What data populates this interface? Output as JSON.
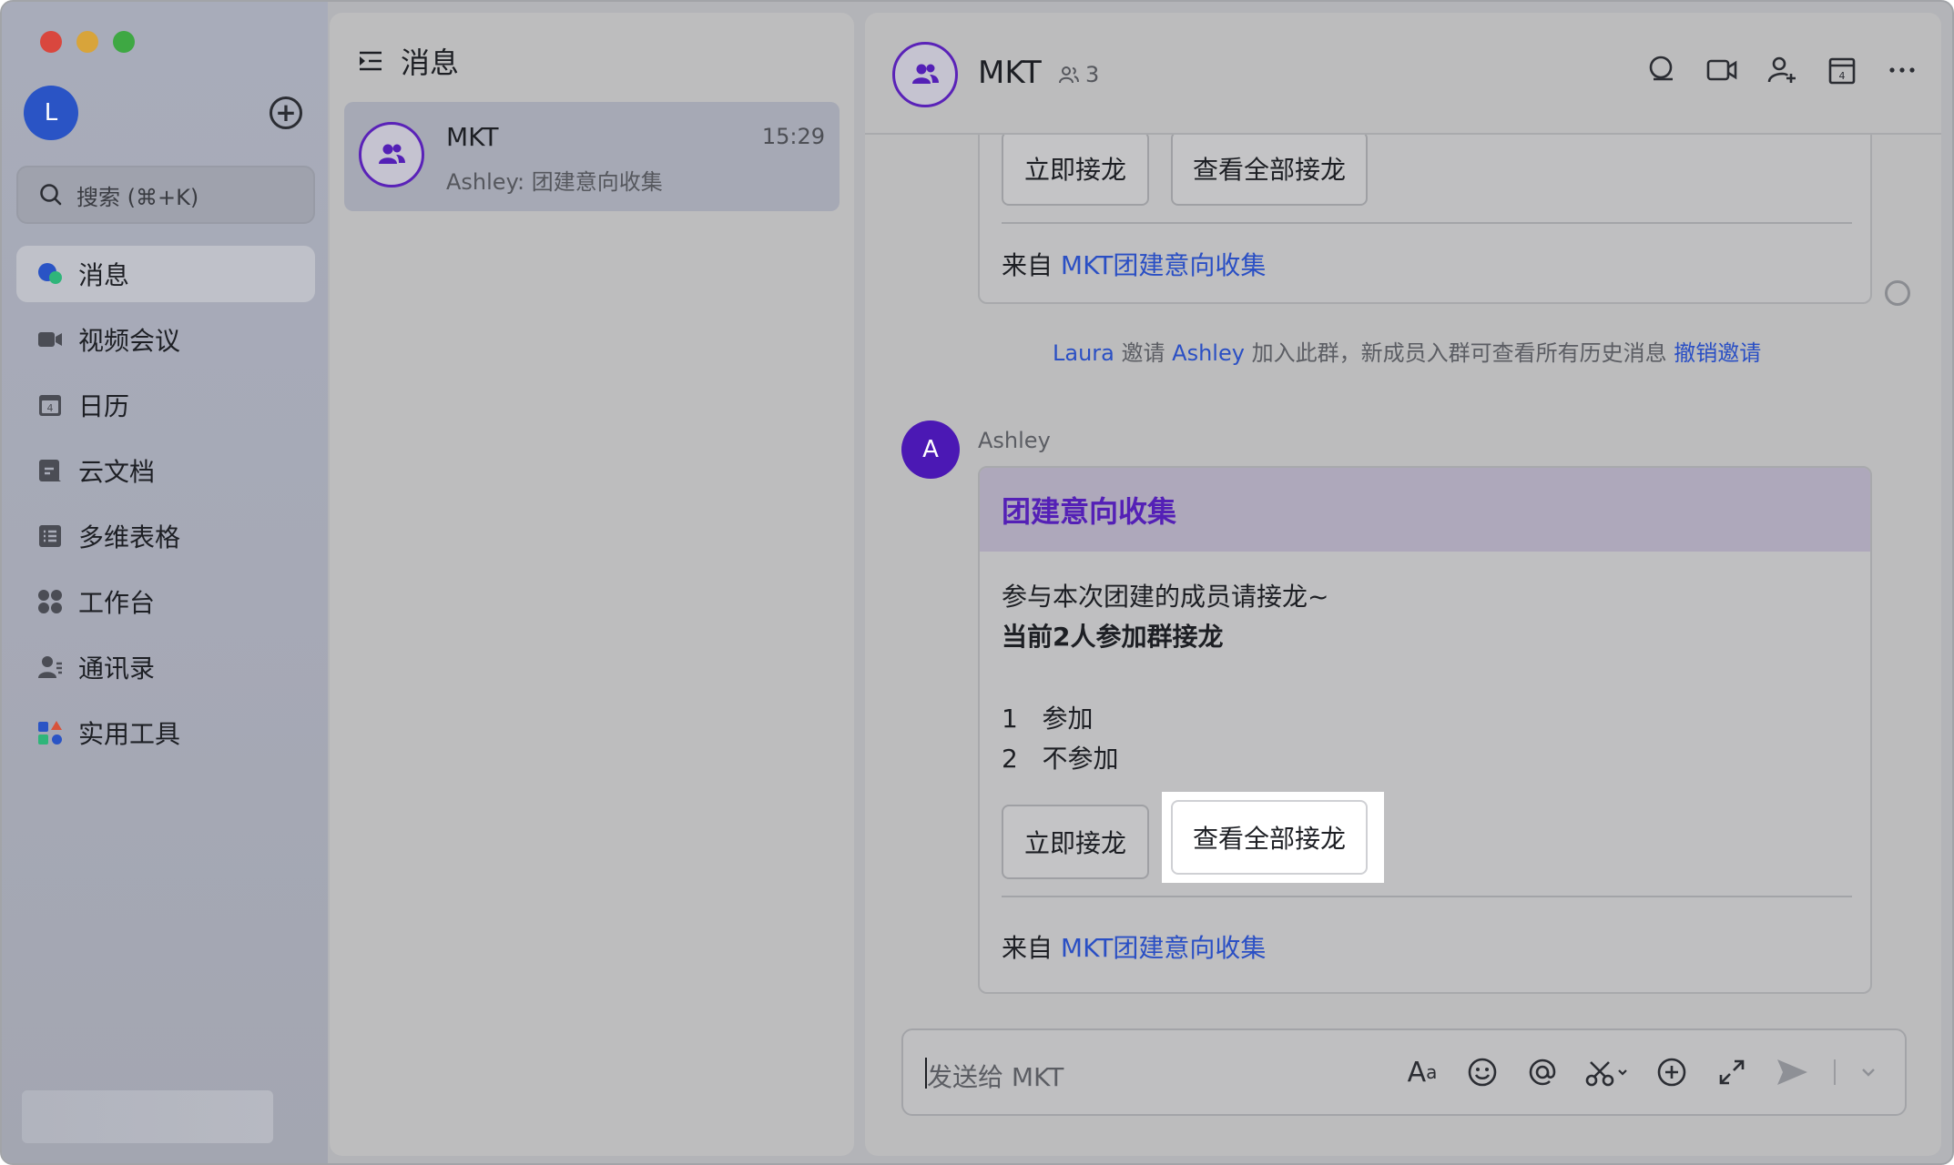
{
  "sidebar": {
    "avatar_letter": "L",
    "search_placeholder": "搜索 (⌘+K)",
    "items": [
      {
        "label": "消息",
        "icon": "chat-bubble-icon"
      },
      {
        "label": "视频会议",
        "icon": "video-camera-icon"
      },
      {
        "label": "日历",
        "icon": "calendar-icon"
      },
      {
        "label": "云文档",
        "icon": "cloud-doc-icon"
      },
      {
        "label": "多维表格",
        "icon": "table-icon"
      },
      {
        "label": "工作台",
        "icon": "workspace-grid-icon"
      },
      {
        "label": "通讯录",
        "icon": "contacts-icon"
      },
      {
        "label": "实用工具",
        "icon": "tools-icon"
      }
    ]
  },
  "chat_list": {
    "title": "消息",
    "items": [
      {
        "name": "MKT",
        "time": "15:29",
        "preview": "Ashley: 团建意向收集"
      }
    ]
  },
  "conversation": {
    "title": "MKT",
    "member_count": "3",
    "prev_card": {
      "btn_join": "立即接龙",
      "btn_view_all": "查看全部接龙",
      "from_prefix": "来自",
      "from_link": "MKT团建意向收集"
    },
    "system_message": {
      "inviter": "Laura",
      "verb": "邀请",
      "invitee": "Ashley",
      "text": "加入此群，新成员入群可查看所有历史消息",
      "revoke": "撤销邀请"
    },
    "message": {
      "sender_initial": "A",
      "sender_name": "Ashley",
      "card_title": "团建意向收集",
      "line1": "参与本次团建的成员请接龙~",
      "line2": "当前2人参加群接龙",
      "option1_num": "1",
      "option1": "参加",
      "option2_num": "2",
      "option2": "不参加",
      "btn_join": "立即接龙",
      "btn_view_all": "查看全部接龙",
      "from_prefix": "来自",
      "from_link": "MKT团建意向收集"
    },
    "input_placeholder": "发送给 MKT"
  },
  "colors": {
    "accent_purple": "#5420b6",
    "link_blue": "#2a4fc4",
    "avatar_blue": "#2a54c5"
  }
}
